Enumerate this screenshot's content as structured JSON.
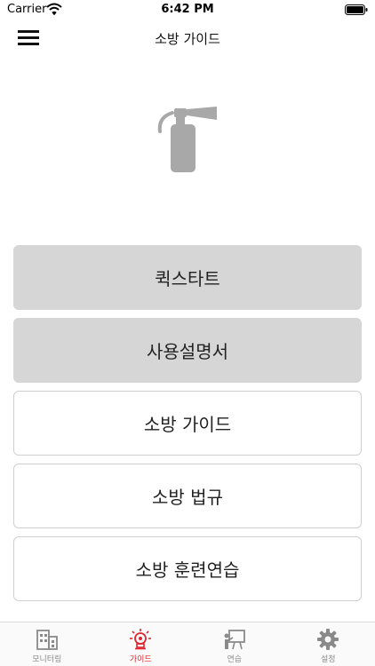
{
  "status_bar": {
    "carrier": "Carrier",
    "time": "6:42 PM"
  },
  "nav": {
    "title": "소방 가이드",
    "menu_icon": "hamburger-menu-icon"
  },
  "hero": {
    "icon": "fire-extinguisher-icon"
  },
  "menu": {
    "items": [
      {
        "label": "퀵스타트"
      },
      {
        "label": "사용설명서"
      },
      {
        "label": "소방 가이드"
      },
      {
        "label": "소방 법규"
      },
      {
        "label": "소방 훈련연습"
      }
    ]
  },
  "tabs": {
    "items": [
      {
        "label": "모니터링",
        "icon": "building-icon"
      },
      {
        "label": "가이드",
        "icon": "alarm-bulb-icon"
      },
      {
        "label": "연습",
        "icon": "training-board-icon"
      },
      {
        "label": "설정",
        "icon": "gear-icon"
      }
    ],
    "active_index": 1
  },
  "colors": {
    "active": "#e0262e",
    "inactive": "#8a8a8a",
    "button_fill": "#d6d6d6",
    "icon_gray": "#a8a8a8"
  }
}
